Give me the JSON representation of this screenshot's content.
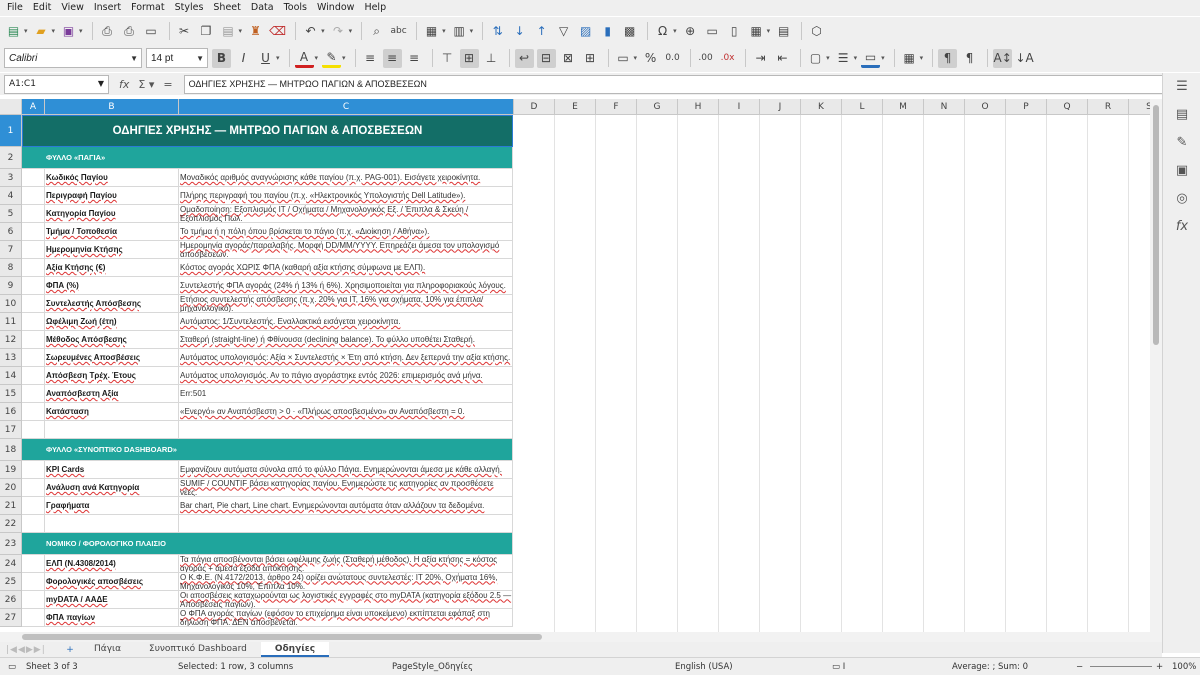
{
  "menu": [
    "File",
    "Edit",
    "View",
    "Insert",
    "Format",
    "Styles",
    "Sheet",
    "Data",
    "Tools",
    "Window",
    "Help"
  ],
  "toolbar": {
    "font_name": "Calibri",
    "font_size": "14 pt"
  },
  "formula_bar": {
    "name_box": "A1:C1",
    "content": "ΟΔΗΓΙΕΣ ΧΡΗΣΗΣ — ΜΗΤΡΩΟ ΠΑΓΙΩΝ & ΑΠΟΣΒΕΣΕΩΝ"
  },
  "columns": [
    "A",
    "B",
    "C",
    "D",
    "E",
    "F",
    "G",
    "H",
    "I",
    "J",
    "K",
    "L",
    "M",
    "N",
    "O",
    "P",
    "Q",
    "R",
    "S"
  ],
  "title": "ΟΔΗΓΙΕΣ ΧΡΗΣΗΣ — ΜΗΤΡΩΟ ΠΑΓΙΩΝ & ΑΠΟΣΒΕΣΕΩΝ",
  "rows": [
    {
      "n": "2",
      "type": "section",
      "b": "ΦΥΛΛΟ «ΠΑΓΙΑ»",
      "c": ""
    },
    {
      "n": "3",
      "b": "Κωδικός Παγίου",
      "c": "Μοναδικός αριθμός αναγνώρισης κάθε παγίου (π.χ. PAG-001). Εισάγετε χειροκίνητα."
    },
    {
      "n": "4",
      "b": "Περιγραφή Παγίου",
      "c": "Πλήρης περιγραφή του παγίου (π.χ. «Ηλεκτρονικός Υπολογιστής Dell Latitude»)."
    },
    {
      "n": "5",
      "b": "Κατηγορία Παγίου",
      "c": "Ομαδοποίηση: Εξοπλισμός IT / Οχήματα / Μηχανολογικός Εξ. / Έπιπλα & Σκεύη / Εξοπλισμός Πωλ."
    },
    {
      "n": "6",
      "b": "Τμήμα / Τοποθεσία",
      "c": "Το τμήμα ή η πόλη όπου βρίσκεται το πάγιο (π.χ. «Διοίκηση / Αθήνα»)."
    },
    {
      "n": "7",
      "b": "Ημερομηνία Κτήσης",
      "c": "Ημερομηνία αγοράς/παραλαβής. Μορφή DD/MM/YYYY. Επηρεάζει άμεσα τον υπολογισμό αποσβέσεων."
    },
    {
      "n": "8",
      "b": "Αξία Κτήσης (€)",
      "c": "Κόστος αγοράς ΧΩΡΙΣ ΦΠΑ (καθαρή αξία κτήσης σύμφωνα με ΕΛΠ)."
    },
    {
      "n": "9",
      "b": "ΦΠΑ (%)",
      "c": "Συντελεστής ΦΠΑ αγοράς (24% ή 13% ή 6%). Χρησιμοποιείται για πληροφοριακούς λόγους."
    },
    {
      "n": "10",
      "b": "Συντελεστής Απόσβεσης",
      "c": "Ετήσιος συντελεστής απόσβεσης (π.χ. 20% για IT, 16% για οχήματα, 10% για έπιπλα/μηχανολογικό)."
    },
    {
      "n": "11",
      "b": "Ωφέλιμη Ζωή (έτη)",
      "c": "Αυτόματος: 1/Συντελεστής. Εναλλακτικά εισάγεται χειροκίνητα."
    },
    {
      "n": "12",
      "b": "Μέθοδος Απόσβεσης",
      "c": "Σταθερή (straight-line) ή Φθίνουσα (declining balance). Το φύλλο υποθέτει Σταθερή."
    },
    {
      "n": "13",
      "b": "Σωρευμένες Αποσβέσεις",
      "c": "Αυτόματος υπολογισμός: Αξία × Συντελεστής × Έτη από κτήση. Δεν ξεπερνά την αξία κτήσης."
    },
    {
      "n": "14",
      "b": "Απόσβεση Τρέχ. Έτους",
      "c": "Αυτόματος υπολογισμός. Αν το πάγιο αγοράστηκε εντός 2026: επιμερισμός ανά μήνα."
    },
    {
      "n": "15",
      "b": "Αναπόσβεστη Αξία",
      "c": "Err:501",
      "plain": true
    },
    {
      "n": "16",
      "b": "Κατάσταση",
      "c": "«Ενεργό» αν Αναπόσβεστη > 0 · «Πλήρως αποσβεσμένο» αν Αναπόσβεστη = 0."
    },
    {
      "n": "17",
      "type": "blank",
      "b": "",
      "c": ""
    },
    {
      "n": "18",
      "type": "section",
      "b": "ΦΥΛΛΟ «ΣΥΝΟΠΤΙΚΟ DASHBOARD»",
      "c": ""
    },
    {
      "n": "19",
      "b": "KPI Cards",
      "c": "Εμφανίζουν αυτόματα σύνολα από το φύλλο Πάγια. Ενημερώνονται άμεσα με κάθε αλλαγή."
    },
    {
      "n": "20",
      "b": "Ανάλυση ανά Κατηγορία",
      "c": "SUMIF / COUNTIF βάσει κατηγορίας παγίου. Ενημερώστε τις κατηγορίες αν προσθέσετε νέες."
    },
    {
      "n": "21",
      "b": "Γραφήματα",
      "c": "Bar chart, Pie chart, Line chart. Ενημερώνονται αυτόματα όταν αλλάζουν τα δεδομένα."
    },
    {
      "n": "22",
      "type": "blank",
      "b": "",
      "c": ""
    },
    {
      "n": "23",
      "type": "section",
      "b": "ΝΟΜΙΚΟ / ΦΟΡΟΛΟΓΙΚΟ ΠΛΑΙΣΙΟ",
      "c": ""
    },
    {
      "n": "24",
      "b": "ΕΛΠ (Ν.4308/2014)",
      "c": "Τα πάγια αποσβένονται βάσει ωφέλιμης ζωής (Σταθερή μέθοδος). Η αξία κτήσης = κόστος αγοράς + άμεσα έξοδα απόκτησης."
    },
    {
      "n": "25",
      "b": "Φορολογικές αποσβέσεις",
      "c": "Ο Κ.Φ.Ε. (Ν.4172/2013, άρθρο 24) ορίζει ανώτατους συντελεστές: IT 20%, Οχήματα 16%, Μηχανολογικός 10%, Έπιπλα 10%."
    },
    {
      "n": "26",
      "b": "myDATA / ΑΑΔΕ",
      "c": "Οι αποσβέσεις καταχωρούνται ως λογιστικές εγγραφές στο myDATA (κατηγορία εξόδου 2.5 — Αποσβέσεις παγίων)."
    },
    {
      "n": "27",
      "b": "ΦΠΑ παγίων",
      "c": "Ο ΦΠΑ αγοράς παγίων (εφόσον το επιχείρημα είναι υποκείμενο) εκπίπτεται εφάπαξ στη δήλωση ΦΠΑ. ΔΕΝ αποσβένεται."
    }
  ],
  "sheet_tabs": [
    "Πάγια",
    "Συνοπτικό Dashboard",
    "Οδηγίες"
  ],
  "active_tab": "Οδηγίες",
  "status": {
    "sheet": "Sheet 3 of 3",
    "selection": "Selected: 1 row, 3 columns",
    "page_style": "PageStyle_Οδηγίες",
    "language": "English (USA)",
    "summary": "Average: ; Sum: 0",
    "zoom": "100%"
  }
}
